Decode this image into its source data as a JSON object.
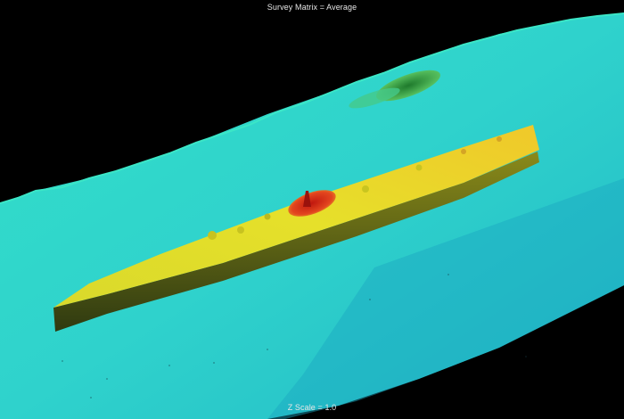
{
  "header": {
    "title": "Survey Matrix = Average"
  },
  "footer": {
    "z_scale_label": "Z Scale = 1.0"
  },
  "colors": {
    "background": "#000000",
    "seafloor": "#2fd6c8",
    "seafloor_dark": "#1fb4b3",
    "debris_green": "#2f9a3a",
    "wreck_yellow": "#e7e22c",
    "wreck_side": "#6d6a12",
    "conning_tower_red": "#d42a1c"
  }
}
